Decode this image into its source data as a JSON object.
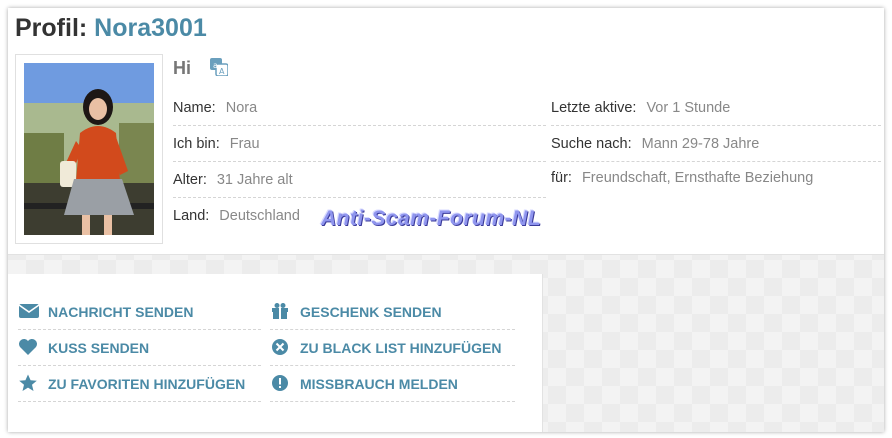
{
  "profile": {
    "title_prefix": "Profil:",
    "username": "Nora3001",
    "greeting": "Hi"
  },
  "details_left": [
    {
      "label": "Name:",
      "value": "Nora"
    },
    {
      "label": "Ich bin:",
      "value": "Frau"
    },
    {
      "label": "Alter:",
      "value": "31 Jahre alt"
    },
    {
      "label": "Land:",
      "value": "Deutschland"
    }
  ],
  "details_right": [
    {
      "label": "Letzte aktive:",
      "value": "Vor 1 Stunde"
    },
    {
      "label": "Suche nach:",
      "value": "Mann 29-78 Jahre"
    },
    {
      "label": "für:",
      "value": "Freundschaft, Ernsthafte Beziehung"
    }
  ],
  "watermark": "Anti-Scam-Forum-NL",
  "actions": [
    {
      "label": "NACHRICHT SENDEN",
      "icon": "envelope-icon"
    },
    {
      "label": "GESCHENK SENDEN",
      "icon": "gift-icon"
    },
    {
      "label": "KUSS SENDEN",
      "icon": "heart-icon"
    },
    {
      "label": "ZU BLACK LIST HINZUFÜGEN",
      "icon": "block-icon"
    },
    {
      "label": "ZU FAVORITEN HINZUFÜGEN",
      "icon": "star-icon"
    },
    {
      "label": "MISSBRAUCH MELDEN",
      "icon": "alert-icon"
    }
  ],
  "colors": {
    "accent": "#4b8aa6",
    "watermark": "#8f95ee"
  }
}
